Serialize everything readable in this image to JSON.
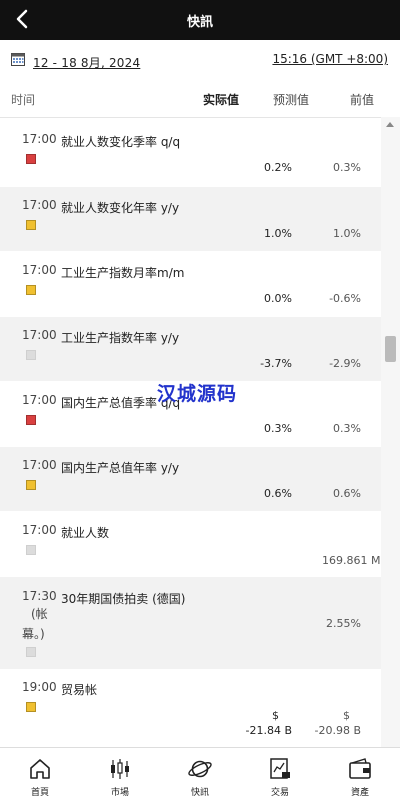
{
  "header": {
    "title": "快訊",
    "back_icon": "chevron-left-icon"
  },
  "datebar": {
    "date_range": "12 - 18 8月, 2024",
    "timezone": "15:16 (GMT +8:00)",
    "calendar_icon": "calendar-icon"
  },
  "columns": {
    "time": "时间",
    "actual": "实际值",
    "forecast": "预测值",
    "previous": "前值"
  },
  "events": [
    {
      "time": "17:00",
      "name": "就业人数变化季率 q/q",
      "importance": "red",
      "actual": "",
      "forecast": "0.2%",
      "previous": "0.3%"
    },
    {
      "time": "17:00",
      "name": "就业人数变化年率 y/y",
      "importance": "yellow",
      "actual": "",
      "forecast": "1.0%",
      "previous": "1.0%"
    },
    {
      "time": "17:00",
      "name": "工业生产指数月率m/m",
      "importance": "yellow",
      "actual": "",
      "forecast": "0.0%",
      "previous": "-0.6%"
    },
    {
      "time": "17:00",
      "name": "工业生产指数年率 y/y",
      "importance": "gray",
      "actual": "",
      "forecast": "-3.7%",
      "previous": "-2.9%"
    },
    {
      "time": "17:00",
      "name": "国内生产总值季率 q/q",
      "importance": "red",
      "actual": "",
      "forecast": "0.3%",
      "previous": "0.3%"
    },
    {
      "time": "17:00",
      "name": "国内生产总值年率 y/y",
      "importance": "yellow",
      "actual": "",
      "forecast": "0.6%",
      "previous": "0.6%"
    },
    {
      "time": "17:00",
      "name": "就业人数",
      "importance": "gray",
      "actual": "",
      "forecast": "",
      "previous": "169.861 M"
    },
    {
      "time": "17:30",
      "name": "30年期国债拍卖 (德国)",
      "note_line1": "(帐",
      "note_line2": "幕。)",
      "importance": "gray",
      "actual": "",
      "forecast": "",
      "previous": "2.55%"
    },
    {
      "time": "19:00",
      "name": "贸易帐",
      "importance": "yellow",
      "actual": "",
      "forecast_line1": "$",
      "forecast_line2": "-21.84 B",
      "previous_line1": "$",
      "previous_line2": "-20.98 B"
    }
  ],
  "watermark": "汉城源码",
  "tabs": [
    {
      "label": "首頁",
      "icon": "home-icon"
    },
    {
      "label": "市場",
      "icon": "candlestick-icon"
    },
    {
      "label": "快訊",
      "icon": "planet-icon"
    },
    {
      "label": "交易",
      "icon": "trade-icon"
    },
    {
      "label": "資產",
      "icon": "wallet-icon"
    }
  ],
  "colors": {
    "header_bg": "#111111",
    "alt_row": "#f2f2f2",
    "importance_red": "#d94040",
    "importance_yellow": "#f0c030",
    "importance_gray": "#dcdcdc"
  }
}
